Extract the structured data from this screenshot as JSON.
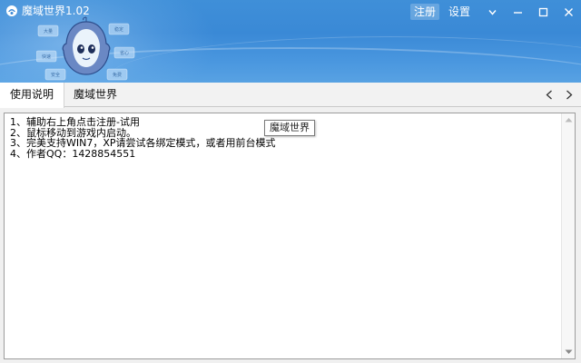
{
  "window": {
    "title": "魔域世界1.02"
  },
  "title_actions": {
    "register": "注册",
    "settings": "设置"
  },
  "mascot_bubbles": [
    "大量",
    "稳定",
    "快速",
    "省心",
    "安全",
    "免费"
  ],
  "tabs": [
    {
      "label": "使用说明",
      "active": true
    },
    {
      "label": "魔域世界",
      "active": false
    }
  ],
  "content": {
    "lines": [
      "1、辅助右上角点击注册-试用",
      "2、鼠标移动到游戏内启动。",
      "3、完美支持WIN7，XP请尝试各绑定模式，或者用前台模式",
      "4、作者QQ：1428854551"
    ]
  },
  "tooltip": {
    "text": "魔域世界"
  },
  "colors": {
    "title_bar": "#3f8fd8",
    "accent": "#4a97df"
  }
}
